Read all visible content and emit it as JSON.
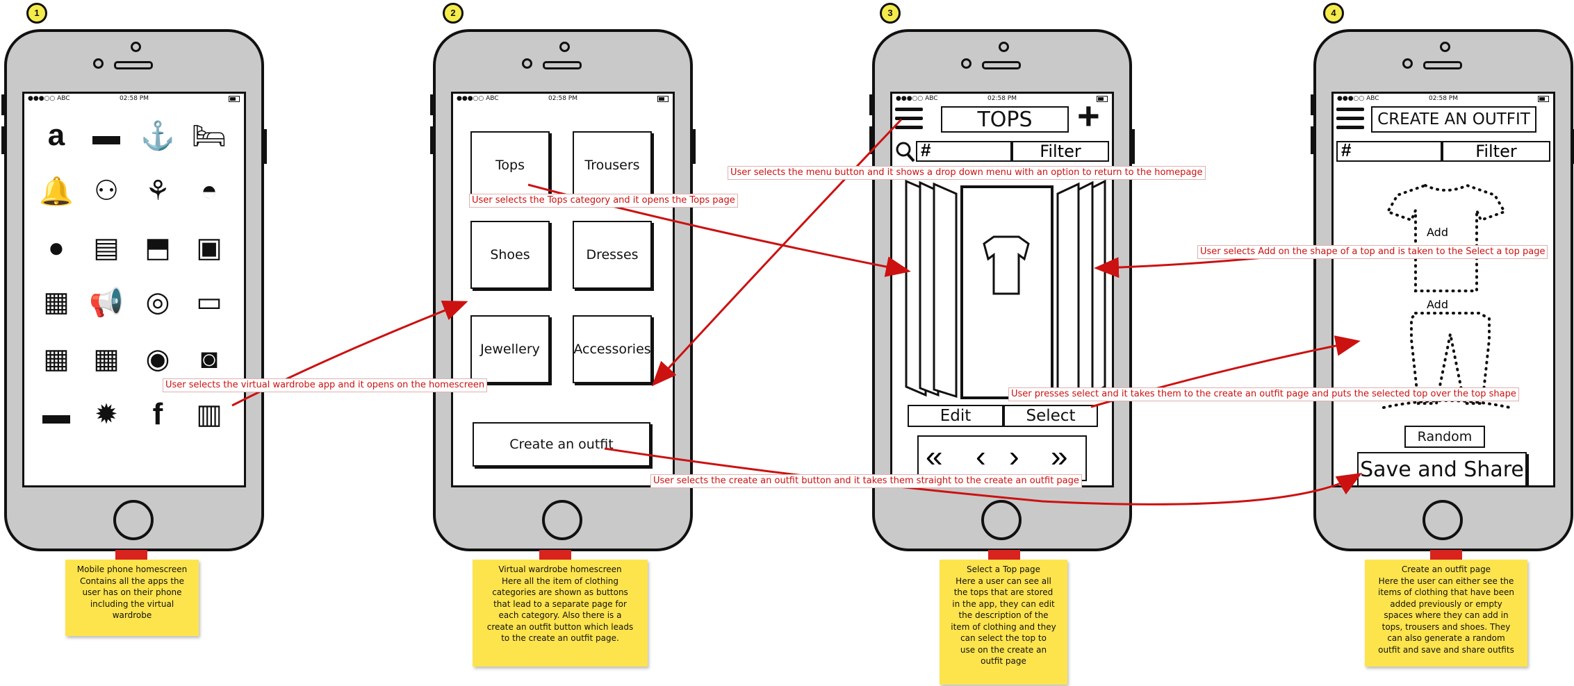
{
  "badges": [
    "1",
    "2",
    "3",
    "4"
  ],
  "status": {
    "carrier": "●●●○○ ABC",
    "time": "02:58 PM"
  },
  "screen1": {
    "icons": [
      "amazon-icon",
      "amex-card-icon",
      "anchor-icon",
      "bed-icon",
      "bell-icon",
      "binoculars-icon",
      "cake-icon",
      "bucket-icon",
      "bomb-icon",
      "book-icon",
      "bookmark-icon",
      "briefcase-icon",
      "building-icon",
      "megaphone-icon",
      "target-icon",
      "bus-icon",
      "calculator-icon",
      "calendar-icon",
      "camera-icon",
      "photo-camera-icon",
      "car-icon",
      "badge-star-icon",
      "facebook-icon",
      "map-icon"
    ],
    "icon_glyphs": [
      "a",
      "▬",
      "⚓",
      "🛏",
      "🔔",
      "⚇",
      "⚘",
      "◓",
      "●",
      "▤",
      "⬒",
      "▣",
      "▦",
      "📢",
      "◎",
      "▭",
      "▦",
      "▦",
      "◉",
      "◙",
      "▬",
      "✹",
      "f",
      "▥"
    ]
  },
  "screen2": {
    "buttons": [
      "Tops",
      "Trousers",
      "Shoes",
      "Dresses",
      "Jewellery",
      "Accessories"
    ],
    "create_button": "Create an outfit"
  },
  "screen3": {
    "title": "TOPS",
    "plus": "+",
    "search_hash": "#",
    "filter": "Filter",
    "edit": "Edit",
    "select": "Select",
    "nav": [
      "«",
      "‹",
      "›",
      "»"
    ]
  },
  "screen4": {
    "title": "CREATE AN OUTFIT",
    "search_hash": "#",
    "filter": "Filter",
    "add_top": "Add",
    "add_bottom": "Add",
    "random": "Random",
    "save": "Save and Share"
  },
  "callouts": {
    "c1": "User selects the virtual wardrobe app and it opens on the homescreen",
    "c2": "User selects the Tops category and it opens the Tops page",
    "c3": "User selects the menu button and it shows a drop down menu with an option to return to the homepage",
    "c4": "User selects Add on the shape of a top and is taken to the Select a top page",
    "c5": "User presses select and it takes them to the create an outfit page and puts the selected top over the top shape",
    "c6": "User selects the create an outfit button and it takes them straight to the create an outfit page"
  },
  "notes": {
    "n1": "Mobile phone homescreen\nContains all the apps the\nuser has on their phone\nincluding the virtual\nwardrobe",
    "n2": "Virtual wardrobe homescreen\nHere all the item of clothing\ncategories are shown as buttons\nthat lead to a separate page for\neach category. Also there is a\ncreate an outfit button which leads\nto the create an outfit page.",
    "n3": "Select a Top page\nHere a user can see all\nthe tops that are stored\nin the app, they can edit\nthe description of the\nitem of clothing and they\ncan select the top to\nuse on the create an\noutfit page",
    "n4": "Create an outfit page\nHere the user can either see the\nitems of clothing that have been\nadded previously or empty\nspaces where they can add in\ntops, trousers and shoes. They\ncan also generate a random\noutfit and save and share outfits"
  },
  "colors": {
    "arrow": "#cc1111",
    "note": "#fde44d",
    "tape": "#d8231f",
    "phone": "#c9c9c9",
    "badge": "#f5ec4c"
  }
}
